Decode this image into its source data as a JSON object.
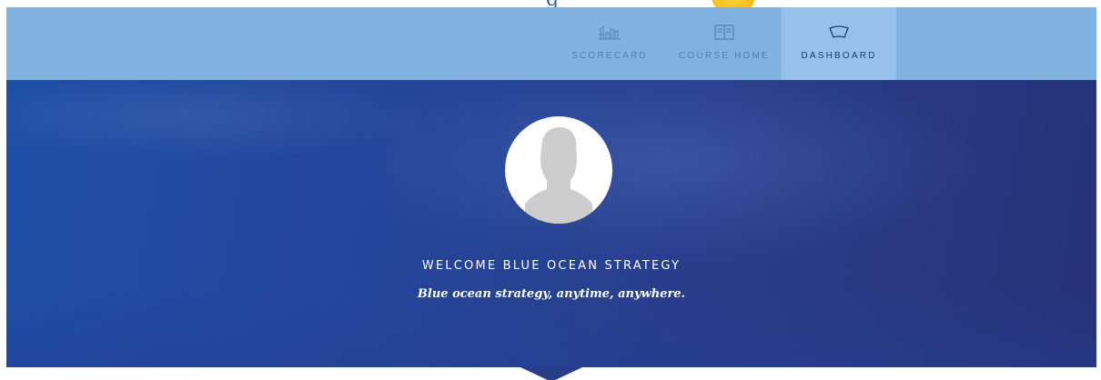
{
  "header": {
    "logo_fragment": "g"
  },
  "nav": {
    "items": [
      {
        "label": "SCORECARD",
        "icon": "scorecard-chart-icon",
        "active": false
      },
      {
        "label": "COURSE HOME",
        "icon": "book-icon",
        "active": false
      },
      {
        "label": "DASHBOARD",
        "icon": "dashboard-gauge-icon",
        "active": true
      }
    ]
  },
  "hero": {
    "welcome": "WELCOME BLUE OCEAN STRATEGY",
    "tagline": "Blue ocean strategy, anytime, anywhere."
  },
  "colors": {
    "nav_bg": "#82b2e0",
    "nav_active_bg": "#95c1ea",
    "hero_bg": "#24469a",
    "badge": "#f4b400"
  }
}
